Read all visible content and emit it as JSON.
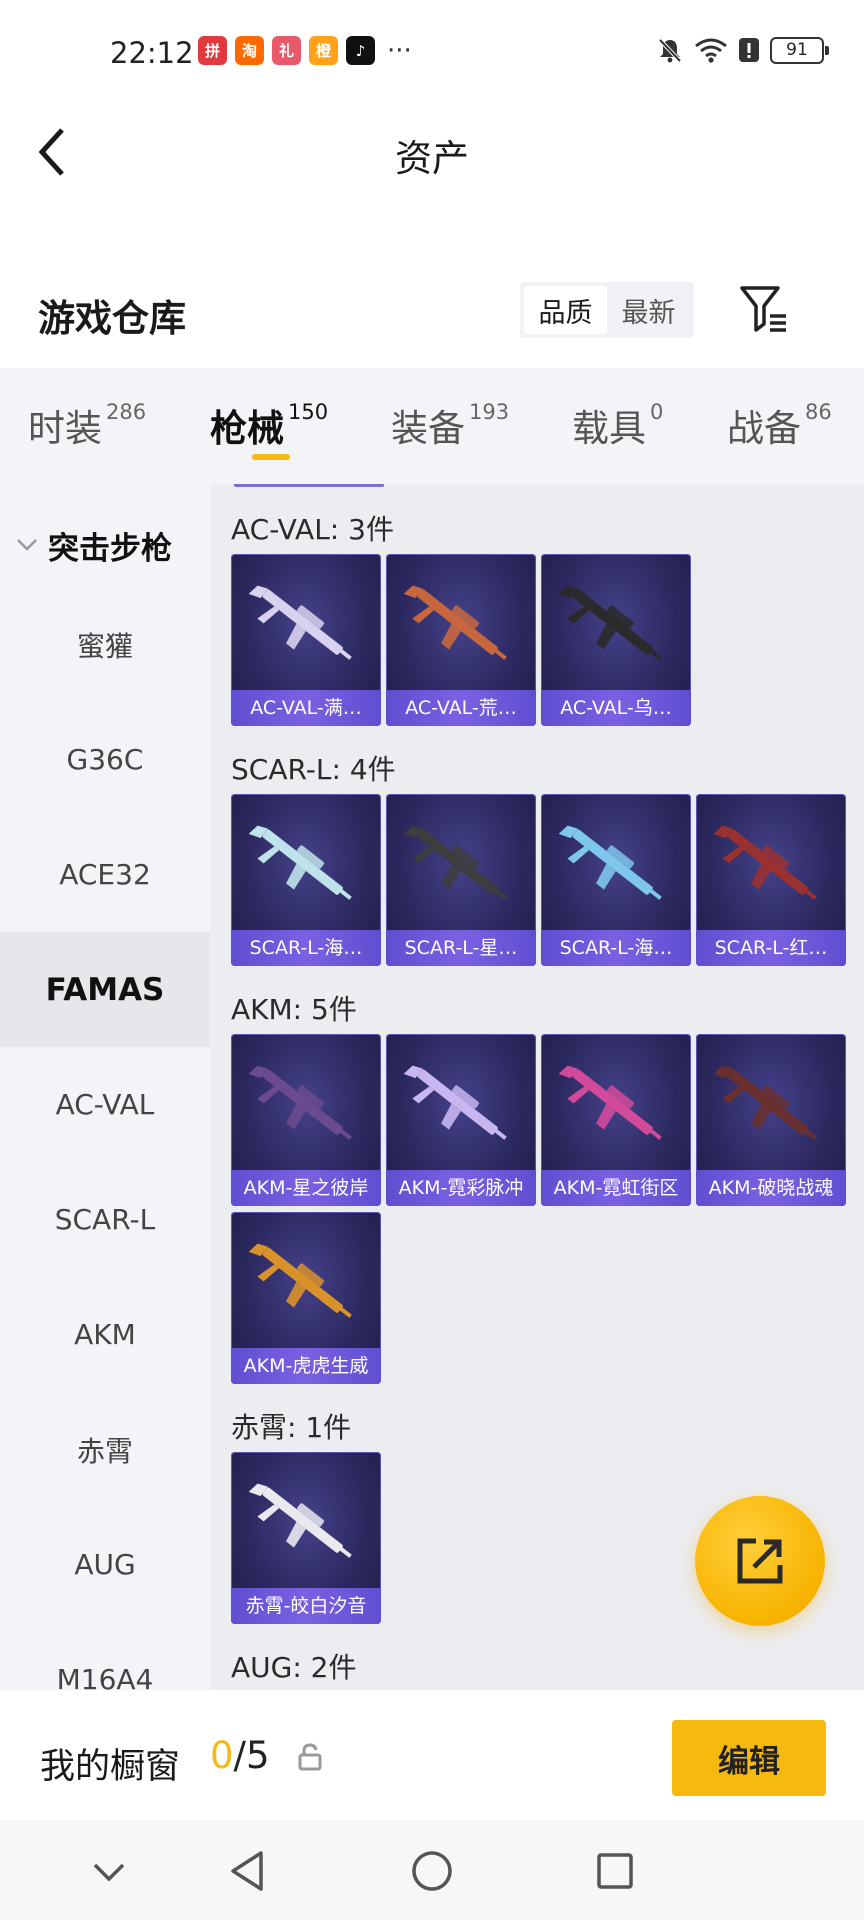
{
  "status_bar": {
    "time": "22:12",
    "app_icons": [
      {
        "name": "pinduoduo-app-icon",
        "glyph": "拼",
        "color": "#e0393e"
      },
      {
        "name": "taobao-app-icon",
        "glyph": "淘",
        "color": "#ff6a00"
      },
      {
        "name": "gift-app-icon",
        "glyph": "礼",
        "color": "#e85a6b"
      },
      {
        "name": "orange-app-icon",
        "glyph": "橙",
        "color": "#ffa21a"
      },
      {
        "name": "tiktok-app-icon",
        "glyph": "♪",
        "color": "#111111"
      }
    ],
    "battery": "91"
  },
  "header": {
    "title": "资产"
  },
  "warehouse": {
    "title": "游戏仓库",
    "sort_options": [
      "品质",
      "最新"
    ],
    "active_sort": "品质"
  },
  "tabs": [
    {
      "label": "时装",
      "count": "286"
    },
    {
      "label": "枪械",
      "count": "150"
    },
    {
      "label": "装备",
      "count": "193"
    },
    {
      "label": "载具",
      "count": "0"
    },
    {
      "label": "战备",
      "count": "86"
    }
  ],
  "active_tab": "枪械",
  "sidebar": {
    "category": "突击步枪",
    "items": [
      "蜜獾",
      "G36C",
      "ACE32",
      "FAMAS",
      "AC-VAL",
      "SCAR-L",
      "AKM",
      "赤霄",
      "AUG",
      "M16A4"
    ],
    "active": "FAMAS"
  },
  "groups": [
    {
      "title": "AC-VAL: 3件",
      "items": [
        {
          "label": "AC-VAL-满…",
          "gun_color": "#d8d2ef"
        },
        {
          "label": "AC-VAL-荒…",
          "gun_color": "#c8673e"
        },
        {
          "label": "AC-VAL-乌…",
          "gun_color": "#2a2a2a"
        }
      ]
    },
    {
      "title": "SCAR-L: 4件",
      "items": [
        {
          "label": "SCAR-L-海…",
          "gun_color": "#bfe3ea"
        },
        {
          "label": "SCAR-L-星…",
          "gun_color": "#3d3d40"
        },
        {
          "label": "SCAR-L-海…",
          "gun_color": "#7fc6ec"
        },
        {
          "label": "SCAR-L-红…",
          "gun_color": "#9a3131"
        }
      ]
    },
    {
      "title": "AKM: 5件",
      "items": [
        {
          "label": "AKM-星之彼岸",
          "gun_color": "#6b4a8f"
        },
        {
          "label": "AKM-霓彩脉冲",
          "gun_color": "#c7b6ef"
        },
        {
          "label": "AKM-霓虹街区",
          "gun_color": "#d34a9a"
        },
        {
          "label": "AKM-破晓战魂",
          "gun_color": "#6a3030"
        },
        {
          "label": "AKM-虎虎生威",
          "gun_color": "#d9912a"
        }
      ]
    },
    {
      "title": "赤霄: 1件",
      "items": [
        {
          "label": "赤霄-皎白汐音",
          "gun_color": "#e9e9ee"
        }
      ]
    },
    {
      "title": "AUG: 2件",
      "items": []
    }
  ],
  "showcase": {
    "label": "我的橱窗",
    "used": "0",
    "total": "/5",
    "edit_label": "编辑"
  },
  "colors": {
    "accent": "#f6b910",
    "item_label": "#6b56d8",
    "item_bg": "#2c2960"
  }
}
